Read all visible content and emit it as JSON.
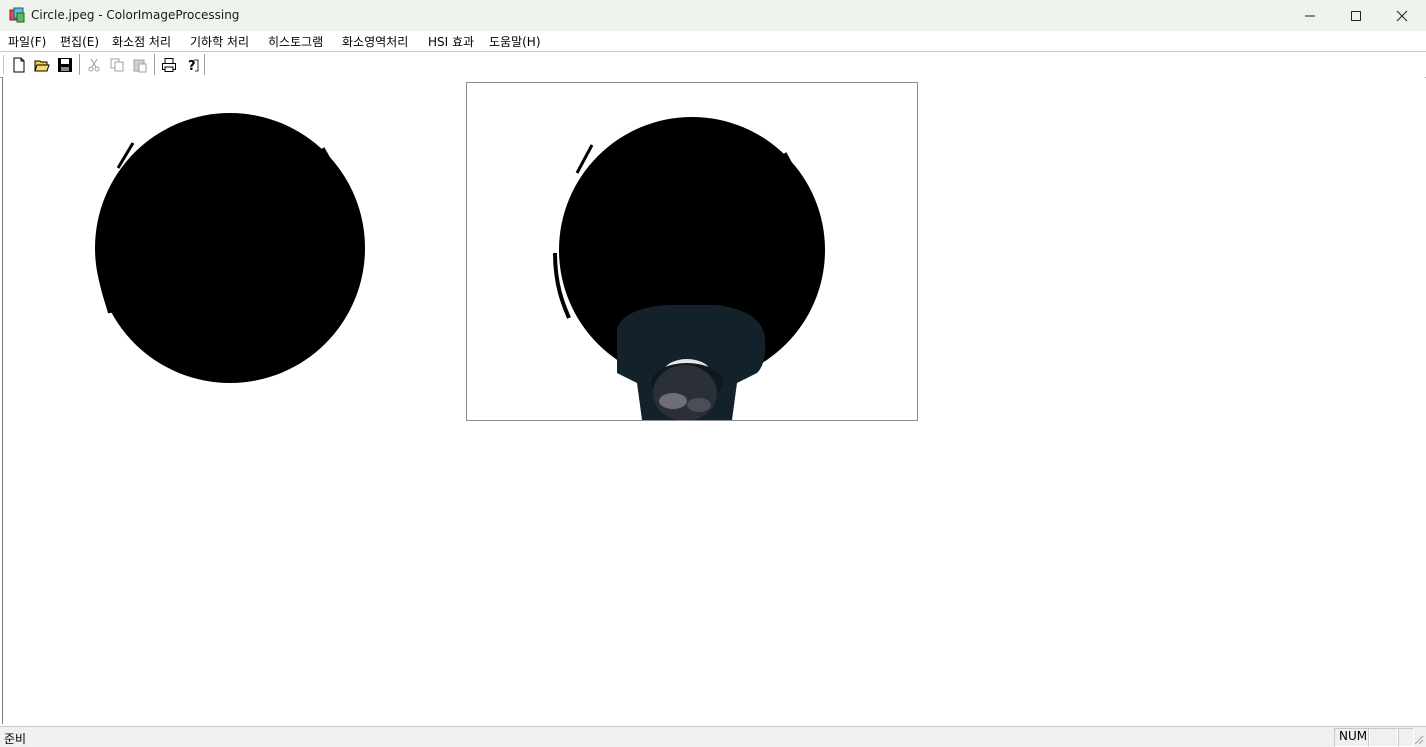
{
  "window": {
    "title": "Circle.jpeg - ColorImageProcessing",
    "icon": "app-image-icon",
    "controls": [
      "minimize-icon",
      "maximize-icon",
      "close-icon"
    ]
  },
  "menu": {
    "items": [
      {
        "label": "파일(F)"
      },
      {
        "label": "편집(E)"
      },
      {
        "label": "화소점 처리"
      },
      {
        "label": "기하학 처리"
      },
      {
        "label": "히스토그램"
      },
      {
        "label": "화소영역처리"
      },
      {
        "label": "HSI 효과"
      },
      {
        "label": "도움말(H)"
      }
    ]
  },
  "toolbar": {
    "buttons": [
      {
        "icon": "new-file-icon",
        "enabled": true
      },
      {
        "icon": "open-folder-icon",
        "enabled": true
      },
      {
        "icon": "save-icon",
        "enabled": true
      },
      {
        "icon": "cut-icon",
        "enabled": false
      },
      {
        "icon": "copy-icon",
        "enabled": false
      },
      {
        "icon": "paste-icon",
        "enabled": false
      },
      {
        "icon": "print-icon",
        "enabled": true
      },
      {
        "icon": "help-icon",
        "enabled": true
      }
    ]
  },
  "canvas": {
    "original_image": "black-circle",
    "result_image": "black-circle-with-person"
  },
  "status": {
    "text": "준비",
    "num": "NUM",
    "empty1": "",
    "empty2": ""
  },
  "colors": {
    "titlebar": "#eef3ee",
    "background": "#ffffff",
    "shape": "#000000"
  }
}
